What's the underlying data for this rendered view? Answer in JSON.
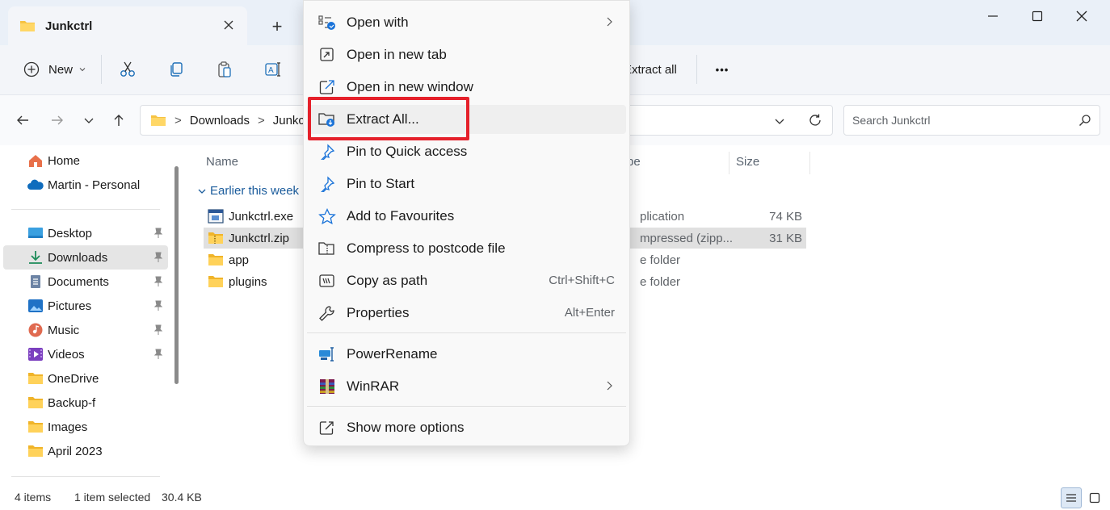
{
  "window": {
    "tab_title": "Junkctrl",
    "new_tab_symbol": "+",
    "controls": [
      "minimize-icon",
      "maximize-icon",
      "close-icon"
    ]
  },
  "toolbar": {
    "new_label": "New",
    "extract_all_label": "Extract all",
    "more_label": "•••",
    "icons": [
      "cut-icon",
      "copy-icon",
      "paste-icon",
      "rename-icon"
    ]
  },
  "address": {
    "crumbs": [
      "Downloads",
      "Junkctrl"
    ],
    "separator": ">",
    "search_placeholder": "Search Junkctrl"
  },
  "sidebar": {
    "items": [
      {
        "label": "Home",
        "icon": "home-icon"
      },
      {
        "label": "Martin - Personal",
        "icon": "onedrive-cloud-icon"
      },
      {
        "label": "Desktop",
        "icon": "desktop-icon",
        "pinned": true
      },
      {
        "label": "Downloads",
        "icon": "download-icon",
        "pinned": true,
        "selected": true
      },
      {
        "label": "Documents",
        "icon": "documents-icon",
        "pinned": true
      },
      {
        "label": "Pictures",
        "icon": "pictures-icon",
        "pinned": true
      },
      {
        "label": "Music",
        "icon": "music-icon",
        "pinned": true
      },
      {
        "label": "Videos",
        "icon": "videos-icon",
        "pinned": true
      },
      {
        "label": "OneDrive",
        "icon": "folder-icon"
      },
      {
        "label": "Backup-f",
        "icon": "folder-icon"
      },
      {
        "label": "Images",
        "icon": "folder-icon"
      },
      {
        "label": "April 2023",
        "icon": "folder-icon"
      }
    ]
  },
  "content": {
    "columns": {
      "name": "Name",
      "type": "pe",
      "size": "Size"
    },
    "group_label": "Earlier this week",
    "files": [
      {
        "name": "Junkctrl.exe",
        "type": "plication",
        "size": "74 KB",
        "icon": "exe-icon"
      },
      {
        "name": "Junkctrl.zip",
        "type": "mpressed (zipp...",
        "size": "31 KB",
        "icon": "zip-folder-icon",
        "selected": true
      },
      {
        "name": "app",
        "type": "e folder",
        "size": "",
        "icon": "folder-icon"
      },
      {
        "name": "plugins",
        "type": "e folder",
        "size": "",
        "icon": "folder-icon"
      }
    ]
  },
  "status": {
    "count": "4 items",
    "selected": "1 item selected",
    "size": "30.4 KB"
  },
  "context_menu": {
    "items": [
      {
        "label": "Open with",
        "icon": "open-with-icon",
        "submenu": true
      },
      {
        "label": "Open in new tab",
        "icon": "open-new-tab-icon"
      },
      {
        "label": "Open in new window",
        "icon": "open-new-window-icon"
      },
      {
        "label": "Extract All...",
        "icon": "extract-all-icon",
        "hover": true
      },
      {
        "label": "Pin to Quick access",
        "icon": "pin-icon"
      },
      {
        "label": "Pin to Start",
        "icon": "pin-start-icon"
      },
      {
        "label": "Add to Favourites",
        "icon": "star-icon"
      },
      {
        "label": "Compress to postcode file",
        "icon": "compress-icon"
      },
      {
        "label": "Copy as path",
        "icon": "copy-path-icon",
        "shortcut": "Ctrl+Shift+C"
      },
      {
        "label": "Properties",
        "icon": "wrench-icon",
        "shortcut": "Alt+Enter"
      },
      {
        "label": "PowerRename",
        "icon": "powerrename-icon"
      },
      {
        "label": "WinRAR",
        "icon": "winrar-icon",
        "submenu": true
      },
      {
        "label": "Show more options",
        "icon": "show-more-icon"
      }
    ]
  },
  "colors": {
    "accent": "#0067c0",
    "highlight_box": "#e5202a",
    "folder_yellow": "#f6c343"
  }
}
